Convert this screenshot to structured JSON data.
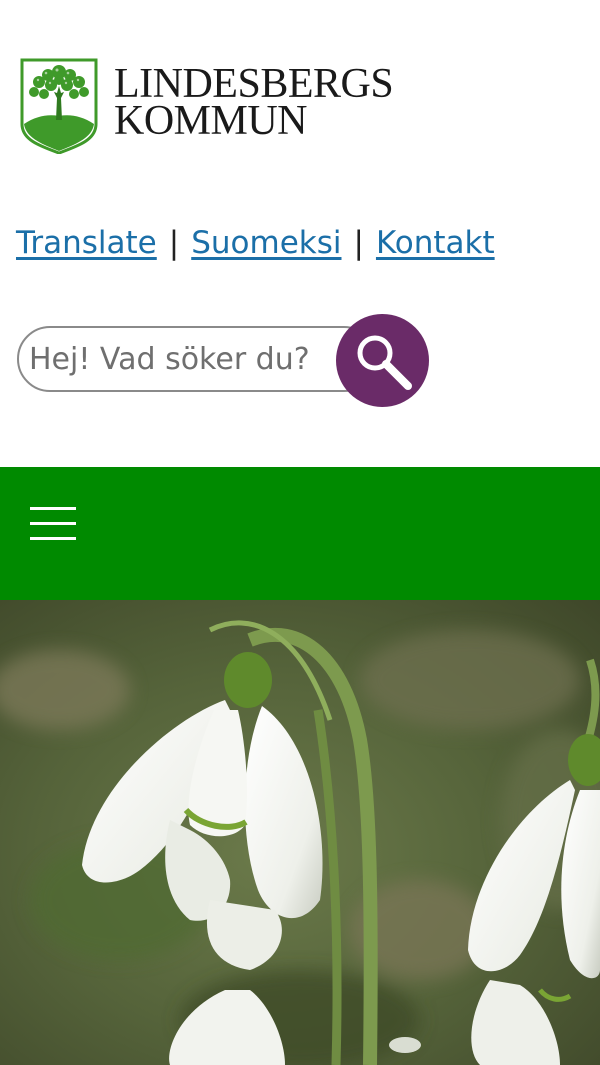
{
  "logo": {
    "line1": "LINDESBERGS",
    "line2": "KOMMUN"
  },
  "util_links": [
    {
      "label": "Translate"
    },
    {
      "label": "Suomeksi"
    },
    {
      "label": "Kontakt "
    }
  ],
  "util_separator": "|",
  "search": {
    "placeholder": "Hej! Vad söker du?",
    "value": "",
    "icon": "magnifier-icon"
  },
  "nav": {
    "menu_icon": "hamburger-menu-icon"
  },
  "colors": {
    "link": "#1b6fa8",
    "search_button": "#6a2b68",
    "nav_bar": "#008a00",
    "logo_green": "#3f9a2a"
  }
}
